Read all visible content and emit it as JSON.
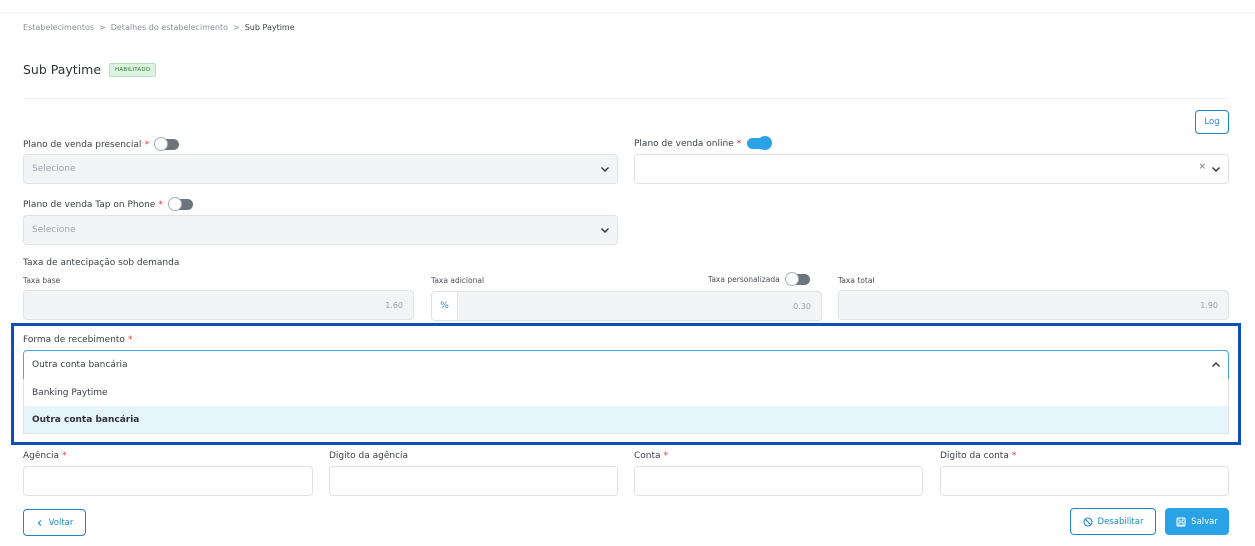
{
  "breadcrumb": {
    "items": [
      "Estabelecimentos",
      "Detalhes do estabelecimento",
      "Sub Paytime"
    ],
    "separator": ">"
  },
  "header": {
    "title": "Sub Paytime",
    "status_badge": "HABILITADO"
  },
  "log_button": "Log",
  "plano_presencial": {
    "label": "Plano de venda presencial",
    "required": "*",
    "toggle_on": false,
    "placeholder": "Selecione"
  },
  "plano_online": {
    "label": "Plano de venda online",
    "required": "*",
    "toggle_on": true,
    "clear": "×"
  },
  "plano_tap": {
    "label": "Plano de venda Tap on Phone",
    "required": "*",
    "toggle_on": false,
    "placeholder": "Selecione"
  },
  "taxa": {
    "section_label": "Taxa de antecipação sob demanda",
    "base_label": "Taxa base",
    "base_value": "1.60",
    "adicional_label": "Taxa adicional",
    "adicional_prefix": "%",
    "adicional_value": "0.30",
    "personalizada_label": "Taxa personalizada",
    "personalizada_on": false,
    "total_label": "Taxa total",
    "total_value": "1.90"
  },
  "forma_recebimento": {
    "label": "Forma de recebimento",
    "required": "*",
    "selected": "Outra conta bancária",
    "options": [
      "Banking Paytime",
      "Outra conta bancária"
    ]
  },
  "bank_fields": {
    "agencia_label": "Agência",
    "agencia_required": "*",
    "digito_agencia_label": "Digito da agência",
    "conta_label": "Conta",
    "conta_required": "*",
    "digito_conta_label": "Digito da conta",
    "digito_conta_required": "*"
  },
  "footer": {
    "voltar": "Voltar",
    "desabilitar": "Desabilitar",
    "salvar": "Salvar"
  },
  "colors": {
    "accent": "#2aa3e6",
    "highlight_border": "#0f4fb8",
    "badge_bg": "#dcf3df",
    "required": "#e53935"
  }
}
